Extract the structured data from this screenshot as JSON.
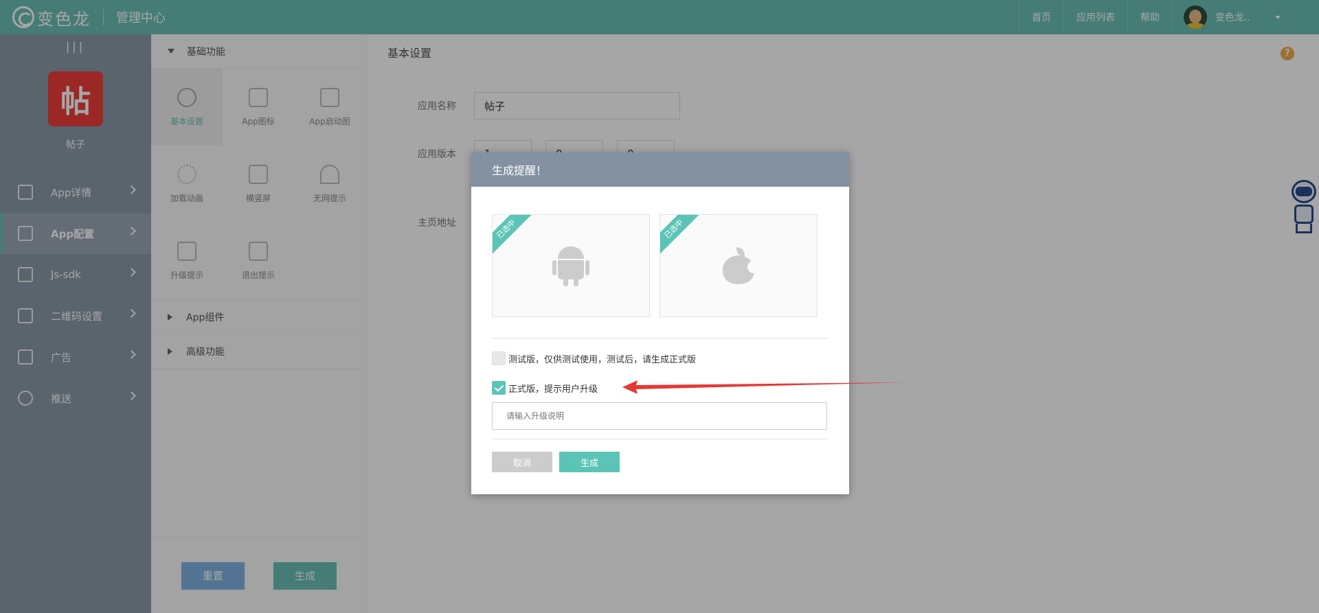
{
  "brand": {
    "logo_text": "变色龙",
    "subtitle": "管理中心"
  },
  "topnav": {
    "items": [
      "首页",
      "应用列表",
      "帮助"
    ],
    "user_name": "变色龙.."
  },
  "sidebar": {
    "toggle": "|||",
    "app_icon_char": "帖",
    "app_name": "帖子",
    "items": [
      {
        "label": "App详情"
      },
      {
        "label": "App配置",
        "active": true
      },
      {
        "label": "Js-sdk"
      },
      {
        "label": "二维码设置"
      },
      {
        "label": "广告"
      },
      {
        "label": "推送"
      }
    ]
  },
  "panel": {
    "sections": [
      "基础功能",
      "App组件",
      "高级功能"
    ],
    "features": [
      "基本设置",
      "App图标",
      "App启动图",
      "加载动画",
      "横竖屏",
      "无网提示",
      "升级提示",
      "退出提示"
    ],
    "active_feature": "基本设置",
    "reset_label": "重置",
    "generate_label": "生成"
  },
  "main": {
    "title": "基本设置",
    "help": "?",
    "fields": {
      "app_name_label": "应用名称",
      "app_name_value": "帖子",
      "app_version_label": "应用版本",
      "version_parts": [
        "1",
        "0",
        "0"
      ],
      "homepage_label": "主页地址"
    }
  },
  "modal": {
    "title": "生成提醒！",
    "platforms": [
      {
        "name": "android",
        "badge": "已选中"
      },
      {
        "name": "apple",
        "badge": "已选中"
      }
    ],
    "test_option": {
      "label": "测试版，仅供测试使用，测试后，请生成正式版",
      "checked": false
    },
    "release_option": {
      "label": "正式版，提示用户升级",
      "checked": true
    },
    "upgrade_placeholder": "请输入升级说明",
    "cancel_label": "取消",
    "confirm_label": "生成"
  },
  "colors": {
    "accent": "#6bc0b6",
    "modal_header": "#8491a1",
    "arrow": "#e53935",
    "app_icon_bg": "#ee3e3a"
  }
}
